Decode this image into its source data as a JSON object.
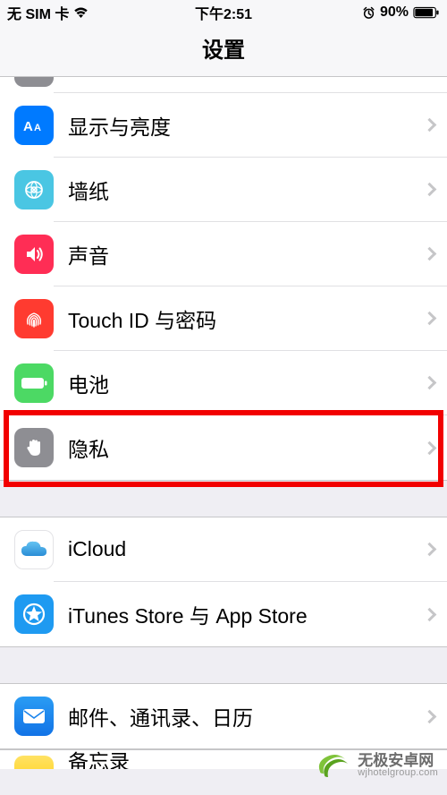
{
  "status": {
    "carrier": "无 SIM 卡",
    "time": "下午2:51",
    "battery_pct": "90%"
  },
  "header": {
    "title": "设置"
  },
  "rows": {
    "display": {
      "label": "显示与亮度"
    },
    "wallpaper": {
      "label": "墙纸"
    },
    "sound": {
      "label": "声音"
    },
    "touchid": {
      "label": "Touch ID 与密码"
    },
    "battery": {
      "label": "电池"
    },
    "privacy": {
      "label": "隐私"
    },
    "icloud": {
      "label": "iCloud"
    },
    "itunes": {
      "label": "iTunes Store 与 App Store"
    },
    "mail": {
      "label": "邮件、通讯录、日历"
    },
    "notes": {
      "label": "备忘录"
    }
  },
  "watermark": {
    "cn": "无极安卓网",
    "url": "wjhotelgroup.com"
  }
}
